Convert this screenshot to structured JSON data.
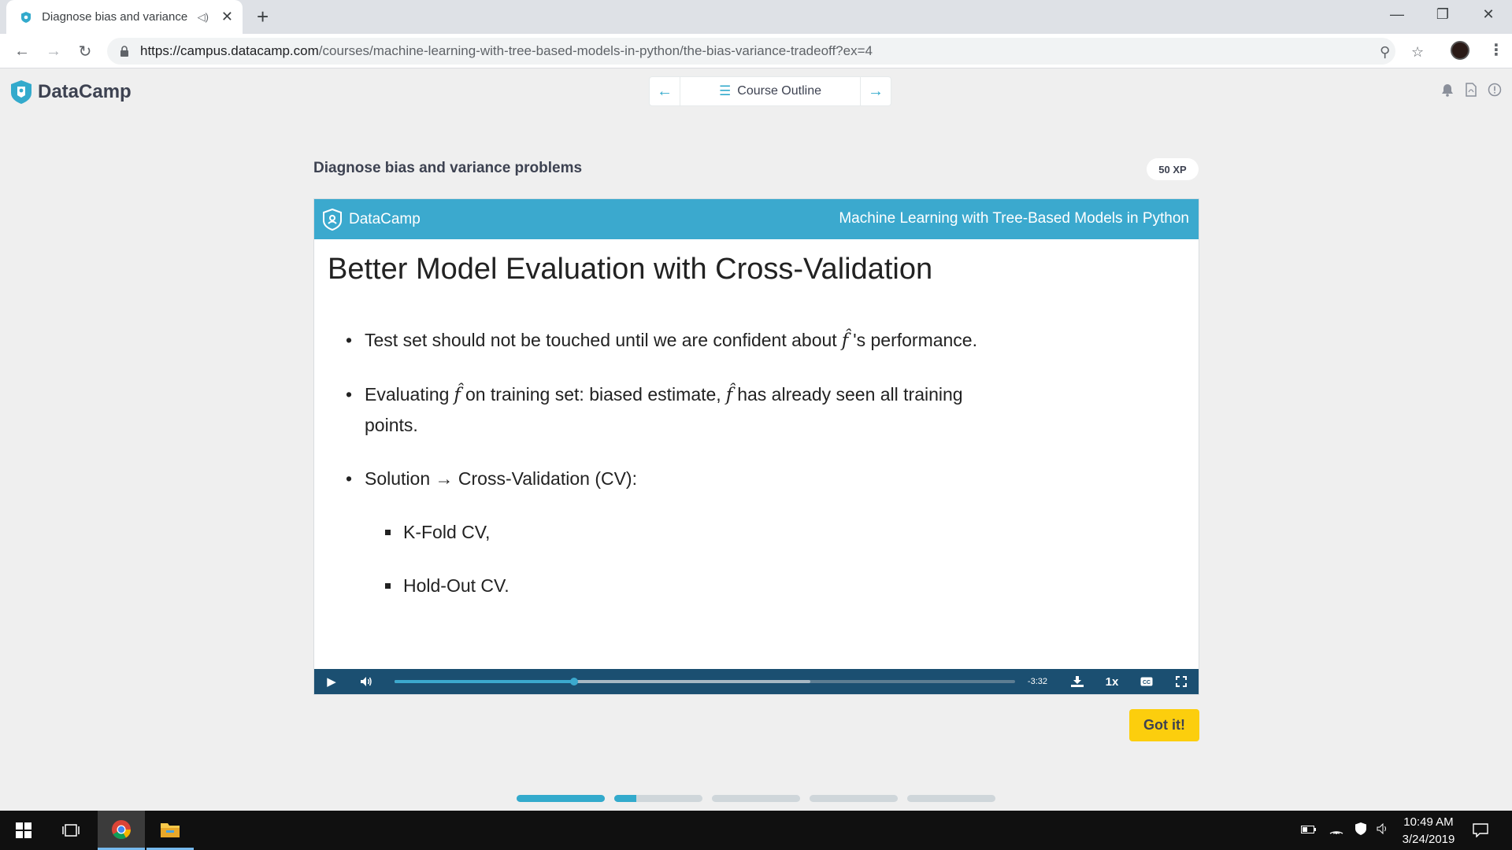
{
  "browser": {
    "tab_title": "Diagnose bias and variance p",
    "url_host": "https://campus.datacamp.com",
    "url_path": "/courses/machine-learning-with-tree-based-models-in-python/the-bias-variance-tradeoff?ex=4"
  },
  "header": {
    "brand": "DataCamp",
    "course_outline_label": "Course Outline"
  },
  "exercise": {
    "title": "Diagnose bias and variance problems",
    "xp": "50 XP",
    "got_it_label": "Got it!"
  },
  "slide": {
    "brand": "DataCamp",
    "course": "Machine Learning with Tree-Based Models in Python",
    "heading": "Better Model Evaluation with Cross-Validation",
    "f_hat": "f̂",
    "b1_a": "Test set should not be touched until we are confident about",
    "b1_b": "'s performance.",
    "b2_a": "Evaluating",
    "b2_b": "on training set: biased estimate,",
    "b2_c": "has already seen all training",
    "b2_d": "points.",
    "b3": "Solution → Cross-Validation (CV):",
    "sub1": "K-Fold CV,",
    "sub2": "Hold-Out CV."
  },
  "player": {
    "time_remaining": "-3:32",
    "speed": "1x",
    "played_fraction": 0.29,
    "buffered_fraction": 0.67
  },
  "progress": {
    "segments": [
      1.0,
      0.25,
      0,
      0,
      0
    ]
  },
  "taskbar": {
    "time": "10:49 AM",
    "date": "3/24/2019"
  },
  "colors": {
    "accent": "#33aacc",
    "slide_bar": "#3ba9ce",
    "player_bg": "#1b4f71",
    "got_it": "#fcce0d"
  }
}
